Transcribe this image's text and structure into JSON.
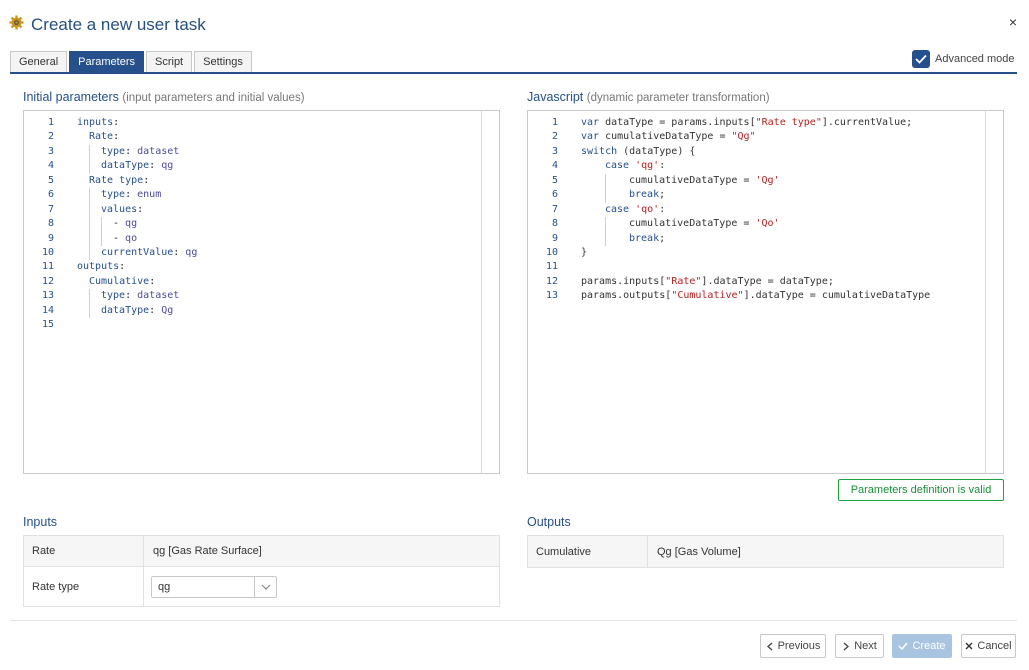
{
  "dialog": {
    "title": "Create a new user task",
    "close": "×"
  },
  "tabs": [
    {
      "label": "General",
      "active": false
    },
    {
      "label": "Parameters",
      "active": true
    },
    {
      "label": "Script",
      "active": false
    },
    {
      "label": "Settings",
      "active": false
    }
  ],
  "advanced_mode": {
    "label": "Advanced mode",
    "checked": true
  },
  "initial_params": {
    "title": "Initial parameters",
    "subtitle": "(input parameters and initial values)"
  },
  "javascript": {
    "title": "Javascript",
    "subtitle": "(dynamic parameter transformation)"
  },
  "validation": {
    "text": "Parameters definition is valid",
    "color": "#1fa342"
  },
  "inputs": {
    "title": "Inputs",
    "rows": [
      {
        "label": "Rate",
        "value": "qg [Gas Rate Surface]"
      },
      {
        "label": "Rate type",
        "select_value": "qg"
      }
    ]
  },
  "outputs": {
    "title": "Outputs",
    "rows": [
      {
        "label": "Cumulative",
        "value": "Qg [Gas Volume]"
      }
    ]
  },
  "buttons": {
    "previous": "Previous",
    "next": "Next",
    "create": "Create",
    "cancel": "Cancel"
  },
  "colors": {
    "accent": "#26508b",
    "valid": "#1fa342",
    "disabled": "#a9c4e0"
  }
}
